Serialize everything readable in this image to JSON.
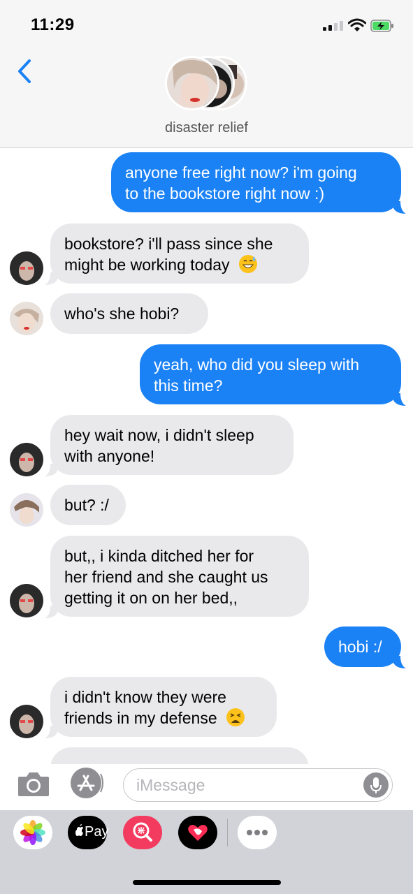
{
  "status_bar": {
    "time": "11:29",
    "icons": [
      "cellular-signal-icon",
      "wifi-icon",
      "battery-charging-icon"
    ]
  },
  "header": {
    "back_icon": "chevron-left-icon",
    "group_name": "disaster relief",
    "accent_color": "#1b82f5"
  },
  "messages": [
    {
      "side": "out",
      "lines": [
        "anyone free right now? i'm going",
        "to the bookstore right now :)"
      ]
    },
    {
      "side": "in",
      "lines": [
        "bookstore? i'll pass since she",
        "might be working today"
      ],
      "emoji": "grinning-sweat-emoji"
    },
    {
      "side": "in",
      "lines": [
        "who's she hobi?"
      ]
    },
    {
      "side": "out",
      "lines": [
        "yeah, who did you sleep with",
        "this time?"
      ]
    },
    {
      "side": "in",
      "lines": [
        "hey wait now, i didn't sleep",
        "with anyone!"
      ]
    },
    {
      "side": "in",
      "lines": [
        "but? :/"
      ]
    },
    {
      "side": "in",
      "lines": [
        "but,, i kinda ditched her for",
        "her friend and she caught us",
        "getting it on on her bed,,"
      ]
    },
    {
      "side": "out",
      "lines": [
        "hobi :/"
      ]
    },
    {
      "side": "in",
      "lines": [
        "i didn't know they were",
        "friends in my defense"
      ],
      "emoji": "tired-face-emoji"
    }
  ],
  "composer": {
    "placeholder": "iMessage",
    "value": "",
    "camera_icon": "camera-icon",
    "appstore_icon": "app-store-icon",
    "mic_icon": "microphone-icon"
  },
  "app_drawer": {
    "apps": [
      {
        "name": "photos-app-icon"
      },
      {
        "name": "apple-pay-app-icon",
        "label": "Pay"
      },
      {
        "name": "images-search-app-icon"
      },
      {
        "name": "digital-touch-app-icon"
      },
      {
        "name": "more-apps-icon"
      }
    ]
  }
}
